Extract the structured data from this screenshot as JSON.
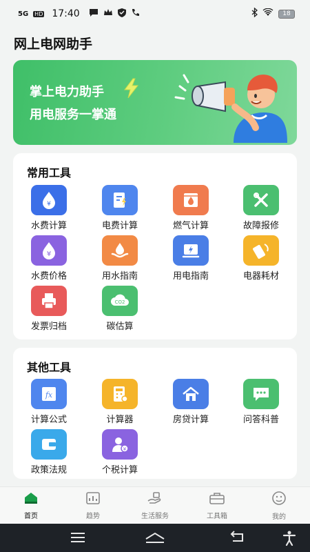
{
  "status_bar": {
    "network": "5G",
    "hd": "HD",
    "time": "17:40",
    "battery": "18"
  },
  "app": {
    "title": "网上电网助手"
  },
  "banner": {
    "title": "掌上电力助手",
    "subtitle": "用电服务一掌通"
  },
  "common_tools": {
    "title": "常用工具",
    "items": [
      {
        "label": "水费计算",
        "icon": "water-drop-icon",
        "color": "#3b6fe8"
      },
      {
        "label": "电费计算",
        "icon": "electric-bill-icon",
        "color": "#4f86ee"
      },
      {
        "label": "燃气计算",
        "icon": "gas-flame-icon",
        "color": "#f07b4e"
      },
      {
        "label": "故障报修",
        "icon": "repair-tools-icon",
        "color": "#4bbf70"
      },
      {
        "label": "水费价格",
        "icon": "water-price-icon",
        "color": "#8a63e0"
      },
      {
        "label": "用水指南",
        "icon": "water-guide-icon",
        "color": "#f28a45"
      },
      {
        "label": "用电指南",
        "icon": "electric-guide-icon",
        "color": "#4a7ee6"
      },
      {
        "label": "电器耗材",
        "icon": "appliance-icon",
        "color": "#f5b42a"
      },
      {
        "label": "发票归档",
        "icon": "invoice-printer-icon",
        "color": "#e85a5a"
      },
      {
        "label": "碳估算",
        "icon": "co2-cloud-icon",
        "color": "#4bbf70"
      }
    ]
  },
  "other_tools": {
    "title": "其他工具",
    "items": [
      {
        "label": "计算公式",
        "icon": "formula-icon",
        "color": "#4f86ee"
      },
      {
        "label": "计算器",
        "icon": "calculator-icon",
        "color": "#f5b42a"
      },
      {
        "label": "房贷计算",
        "icon": "house-loan-icon",
        "color": "#4a7ee6"
      },
      {
        "label": "问答科普",
        "icon": "chat-qa-icon",
        "color": "#4bbf70"
      },
      {
        "label": "政策法规",
        "icon": "policy-wallet-icon",
        "color": "#3aa9ea"
      },
      {
        "label": "个税计算",
        "icon": "income-tax-icon",
        "color": "#8a63e0"
      }
    ]
  },
  "bottom_nav": {
    "items": [
      {
        "label": "首页",
        "icon": "home-icon"
      },
      {
        "label": "趋势",
        "icon": "trend-chart-icon"
      },
      {
        "label": "生活服务",
        "icon": "life-service-icon"
      },
      {
        "label": "工具箱",
        "icon": "toolbox-icon"
      },
      {
        "label": "我的",
        "icon": "profile-face-icon"
      }
    ]
  },
  "colors": {
    "accent_green": "#3fbf68",
    "active_nav": "#1a9e4a"
  }
}
